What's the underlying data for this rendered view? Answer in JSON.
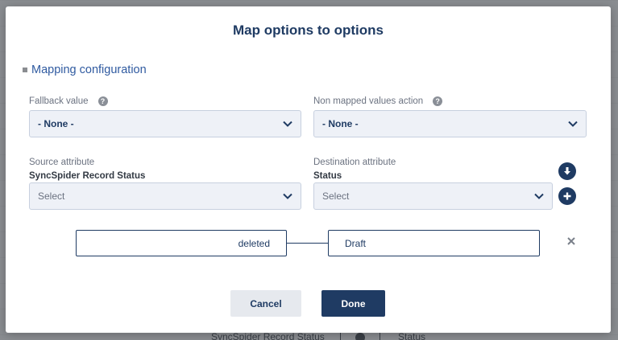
{
  "modal": {
    "title": "Map options to options",
    "section_title": "Mapping configuration"
  },
  "fallback": {
    "label": "Fallback value",
    "value": "- None -"
  },
  "non_mapped": {
    "label": "Non mapped values action",
    "value": "- None -"
  },
  "source": {
    "label": "Source attribute",
    "name": "SyncSpider Record Status",
    "select_value": "Select"
  },
  "destination": {
    "label": "Destination attribute",
    "name": "Status",
    "select_value": "Select"
  },
  "mapping_row": {
    "source_value": "deleted",
    "destination_value": "Draft"
  },
  "buttons": {
    "cancel": "Cancel",
    "done": "Done"
  },
  "backdrop": {
    "source_text": "SyncSpider Record Status",
    "destination_text": "Status"
  },
  "colors": {
    "primary": "#1f3b63",
    "input_bg": "#eef1f7",
    "overlay": "#8a8d91"
  },
  "icons": {
    "help": "question-circle-icon",
    "chevron": "chevron-down-icon",
    "download": "arrow-down-circle-icon",
    "add": "plus-circle-icon",
    "remove": "close-icon"
  }
}
